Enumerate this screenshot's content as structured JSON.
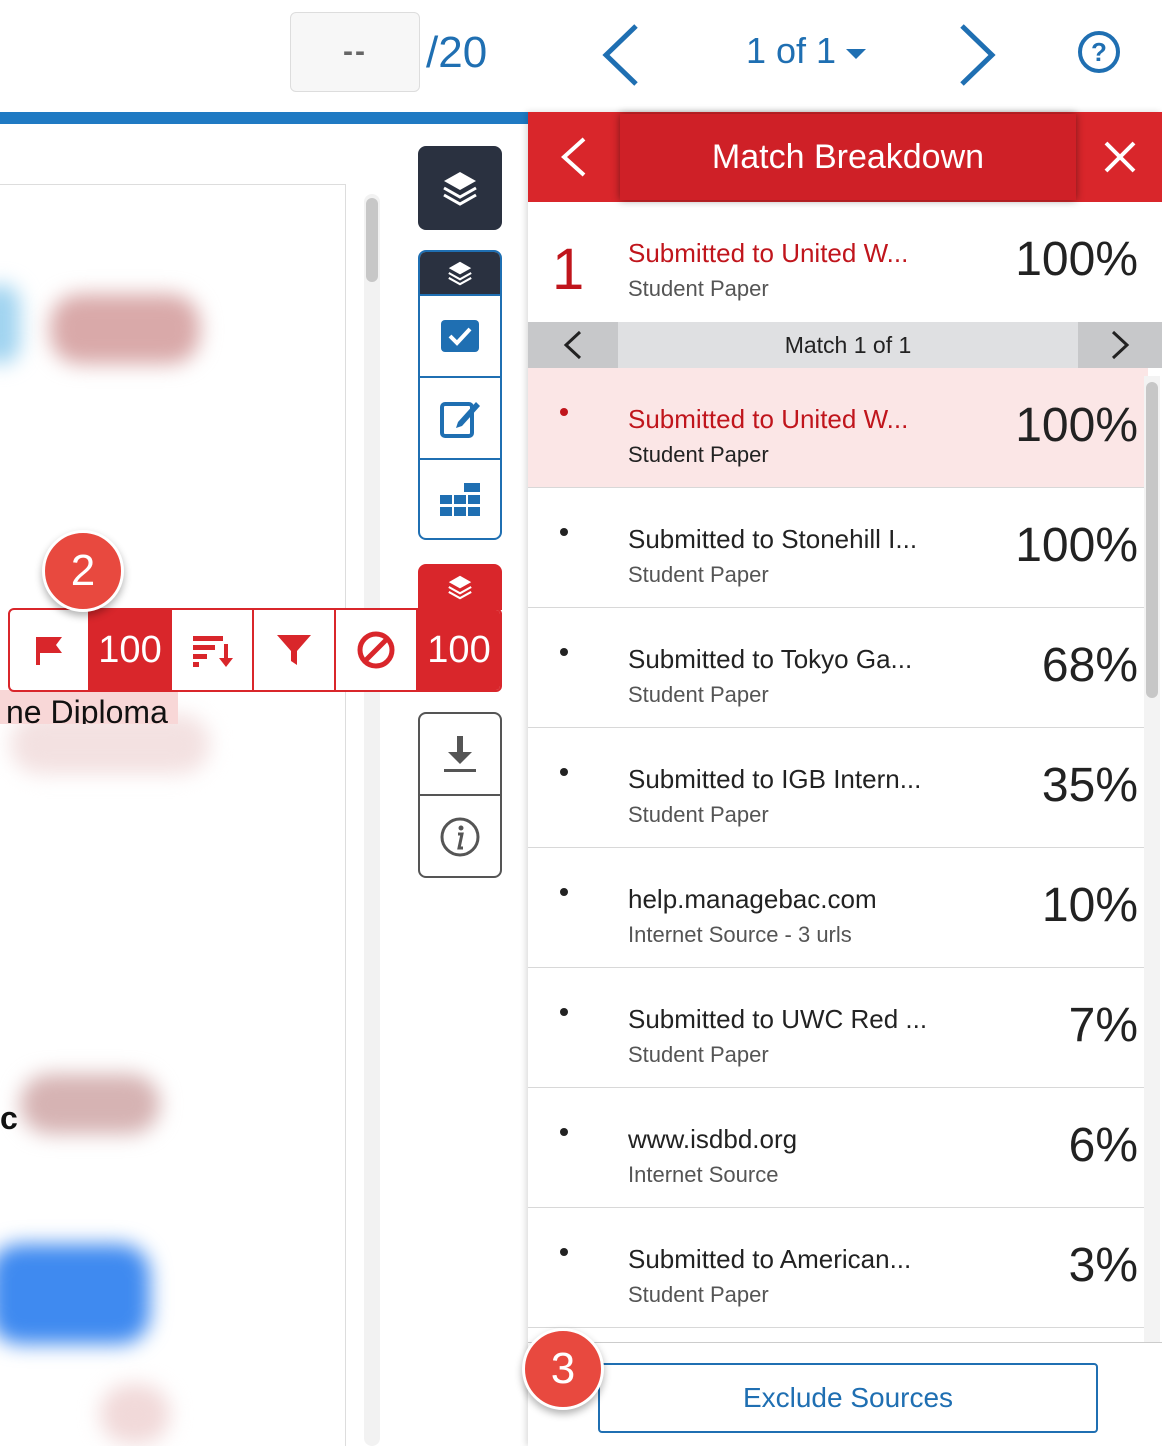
{
  "toolbar": {
    "score_placeholder": "--",
    "score_total": "/20",
    "page_label": "1 of 1",
    "help_label": "?"
  },
  "document": {
    "visible_fragment": "ne Diploma",
    "bold_fragment": "c"
  },
  "highlight_bar": {
    "left_count": "100",
    "right_count": "100"
  },
  "badges": {
    "step2": "2",
    "step3": "3"
  },
  "panel": {
    "title": "Match Breakdown",
    "top_match": {
      "rank": "1",
      "source": "Submitted to United W...",
      "type": "Student Paper",
      "percent": "100%"
    },
    "match_nav_label": "Match 1 of 1",
    "sources": [
      {
        "title": "Submitted to United W...",
        "type": "Student Paper",
        "percent": "100%"
      },
      {
        "title": "Submitted to Stonehill I...",
        "type": "Student Paper",
        "percent": "100%"
      },
      {
        "title": "Submitted to Tokyo Ga...",
        "type": "Student Paper",
        "percent": "68%"
      },
      {
        "title": "Submitted to IGB Intern...",
        "type": "Student Paper",
        "percent": "35%"
      },
      {
        "title": "help.managebac.com",
        "type": "Internet Source - 3 urls",
        "percent": "10%"
      },
      {
        "title": "Submitted to UWC Red ...",
        "type": "Student Paper",
        "percent": "7%"
      },
      {
        "title": "www.isdbd.org",
        "type": "Internet Source",
        "percent": "6%"
      },
      {
        "title": "Submitted to American...",
        "type": "Student Paper",
        "percent": "3%"
      }
    ],
    "exclude_label": "Exclude Sources"
  },
  "colors": {
    "accent_red": "#d9262b",
    "link_blue": "#1f6fb2",
    "dark": "#2a3140"
  }
}
